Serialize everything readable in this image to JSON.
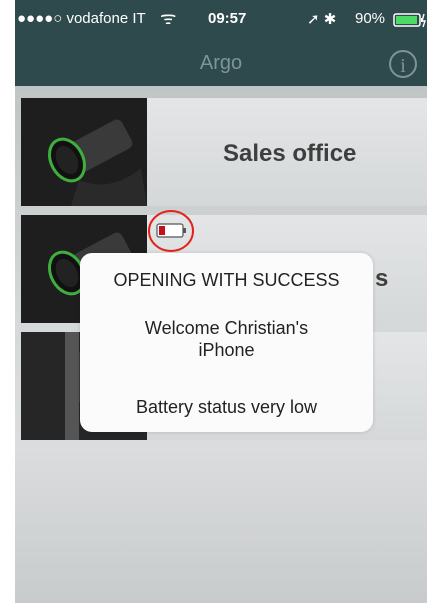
{
  "status_bar": {
    "carrier": "●●●●○ vodafone IT",
    "wifi": "ᯤ",
    "time": "09:57",
    "icons": "➚ ✱",
    "battery_percent": "90%"
  },
  "nav": {
    "title": "Argo",
    "info_label": "i"
  },
  "doors": [
    {
      "label": "Sales office"
    },
    {
      "label": "s"
    },
    {
      "label": ""
    }
  ],
  "alert": {
    "title": "OPENING WITH SUCCESS",
    "message_line1": "Welcome Christian's",
    "message_line2": "iPhone",
    "message_line3": "Battery status very low"
  },
  "colors": {
    "nav_bg": "#2f4a4d",
    "nav_text": "#7f9495",
    "battery_low": "#c0121b",
    "annotation_circle": "#e2231a",
    "status_battery": "#4cd964"
  },
  "icons": {
    "lock_cylinder": "lock-cylinder-icon",
    "low_battery": "battery-low-icon",
    "info": "info-icon",
    "wifi": "wifi-icon",
    "location": "location-icon",
    "bluetooth": "bluetooth-icon"
  }
}
